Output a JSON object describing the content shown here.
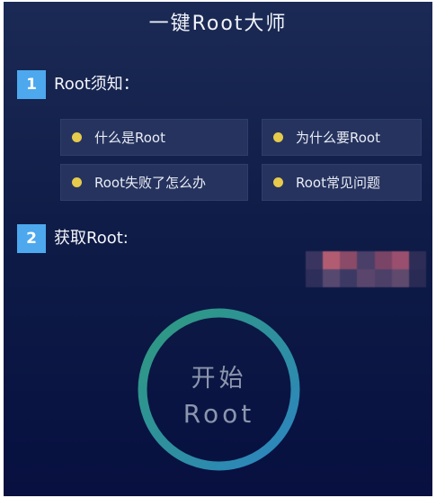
{
  "header": {
    "title": "一键Root大师"
  },
  "section1": {
    "number": "1",
    "label": "Root须知：",
    "items": [
      {
        "label": "什么是Root"
      },
      {
        "label": "为什么要Root"
      },
      {
        "label": "Root失败了怎么办"
      },
      {
        "label": "Root常见问题"
      }
    ]
  },
  "section2": {
    "number": "2",
    "label": "获取Root:"
  },
  "start_button": {
    "line1": "开始",
    "line2": "Root"
  },
  "colors": {
    "badge": "#4da8ee",
    "dot": "#e5ca4c",
    "ring_start": "#2f9a7e",
    "ring_end": "#2c84c4"
  }
}
